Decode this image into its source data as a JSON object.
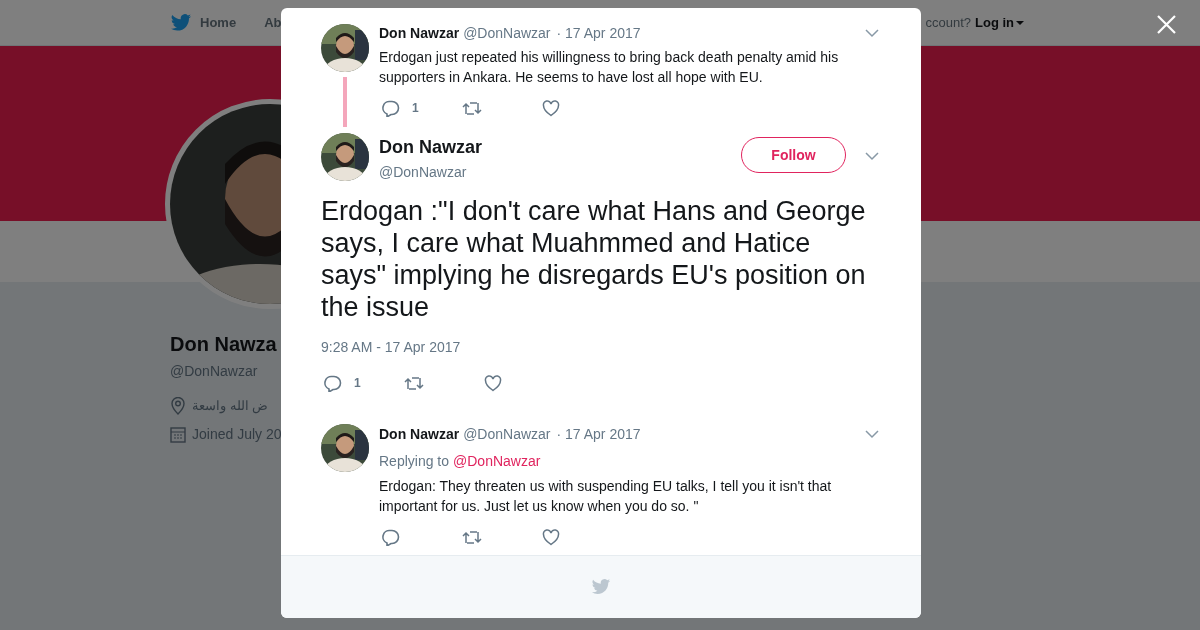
{
  "nav": {
    "home": "Home",
    "about": "Ab",
    "login_prompt": "ccount?",
    "login": "Log in"
  },
  "profile": {
    "name": "Don Nawza",
    "handle": "@DonNawzar",
    "location": "ض الله واسعة",
    "joined": "Joined July 20"
  },
  "modal": {
    "parent_tweet": {
      "name": "Don Nawzar",
      "handle": "@DonNawzar",
      "date": "· 17 Apr 2017",
      "text": "Erdogan just repeated his willingness to bring back death penalty amid his supporters in Ankara. He seems to have lost all hope with EU.",
      "replies": "1"
    },
    "main_tweet": {
      "name": "Don Nawzar",
      "handle": "@DonNawzar",
      "follow": "Follow",
      "text": "Erdogan :\"I don't care what Hans and George says, I care what Muahmmed and Hatice says\" implying he disregards EU's position on the issue",
      "time": "9:28 AM - 17 Apr 2017",
      "replies": "1"
    },
    "reply_tweet": {
      "name": "Don Nawzar",
      "handle": "@DonNawzar",
      "date": "· 17 Apr 2017",
      "replying_label": "Replying to",
      "replying_to": "@DonNawzar",
      "text": "Erdogan: They threaten us with suspending EU talks, I tell you it isn't that important for us. Just let us know when you do so. \""
    }
  }
}
